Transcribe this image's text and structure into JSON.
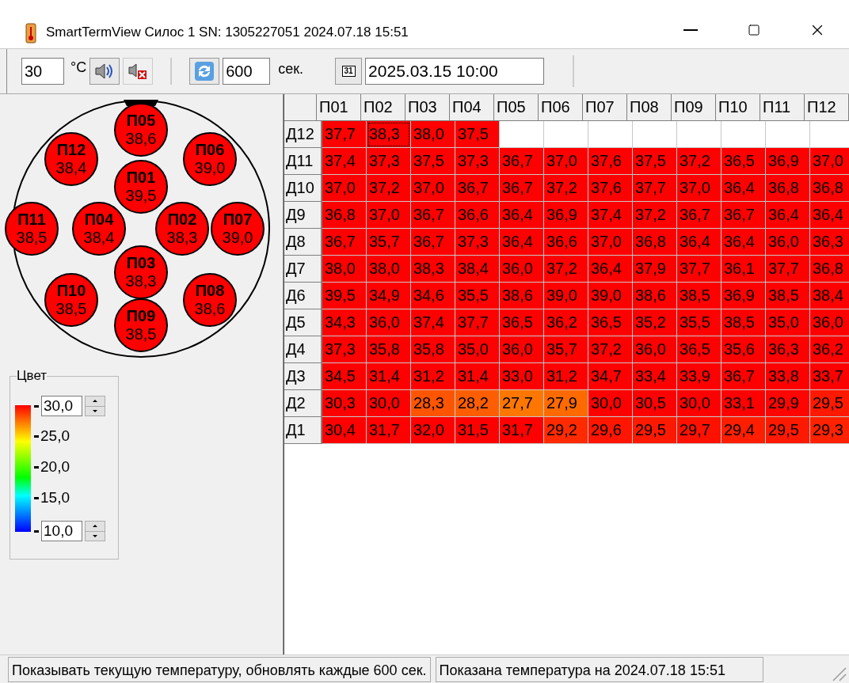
{
  "window": {
    "title": "SmartTermView Силос 1  SN: 1305227051  2024.07.18 15:51"
  },
  "toolbar": {
    "alarm_temp": "30",
    "temp_unit": "°C",
    "interval": "600",
    "interval_unit": "сек.",
    "calendar_glyph": "31",
    "date": "2025.03.15 10:00"
  },
  "silo": {
    "probes": [
      {
        "label": "П01",
        "value": "39,5"
      },
      {
        "label": "П02",
        "value": "38,3"
      },
      {
        "label": "П03",
        "value": "38,3"
      },
      {
        "label": "П04",
        "value": "38,4"
      },
      {
        "label": "П05",
        "value": "38,6"
      },
      {
        "label": "П06",
        "value": "39,0"
      },
      {
        "label": "П07",
        "value": "39,0"
      },
      {
        "label": "П08",
        "value": "38,6"
      },
      {
        "label": "П09",
        "value": "38,5"
      },
      {
        "label": "П10",
        "value": "38,5"
      },
      {
        "label": "П11",
        "value": "38,5"
      },
      {
        "label": "П12",
        "value": "38,4"
      }
    ]
  },
  "legend": {
    "title": "Цвет",
    "max": "30,0",
    "ticks": [
      "25,0",
      "20,0",
      "15,0"
    ],
    "min": "10,0"
  },
  "table": {
    "columns": [
      "П01",
      "П02",
      "П03",
      "П04",
      "П05",
      "П06",
      "П07",
      "П08",
      "П09",
      "П10",
      "П11",
      "П12"
    ],
    "rows": [
      {
        "label": "Д12",
        "cells": [
          {
            "v": "37,7",
            "selected": false
          },
          {
            "v": "38,3",
            "selected": true
          },
          {
            "v": "38,0",
            "selected": false
          },
          {
            "v": "37,5",
            "selected": false
          }
        ]
      },
      {
        "label": "Д11",
        "cells": [
          {
            "v": "37,4",
            "selected": false
          },
          {
            "v": "37,3",
            "selected": false
          },
          {
            "v": "37,5",
            "selected": false
          },
          {
            "v": "37,3",
            "selected": false
          },
          {
            "v": "36,7",
            "selected": false
          },
          {
            "v": "37,0",
            "selected": false
          },
          {
            "v": "37,6",
            "selected": false
          },
          {
            "v": "37,5",
            "selected": false
          },
          {
            "v": "37,2",
            "selected": false
          },
          {
            "v": "36,5",
            "selected": false
          },
          {
            "v": "36,9",
            "selected": false
          },
          {
            "v": "37,0",
            "selected": false
          }
        ]
      },
      {
        "label": "Д10",
        "cells": [
          {
            "v": "37,0",
            "selected": false
          },
          {
            "v": "37,2",
            "selected": false
          },
          {
            "v": "37,0",
            "selected": false
          },
          {
            "v": "36,7",
            "selected": false
          },
          {
            "v": "36,7",
            "selected": false
          },
          {
            "v": "37,2",
            "selected": false
          },
          {
            "v": "37,6",
            "selected": false
          },
          {
            "v": "37,7",
            "selected": false
          },
          {
            "v": "37,0",
            "selected": false
          },
          {
            "v": "36,4",
            "selected": false
          },
          {
            "v": "36,8",
            "selected": false
          },
          {
            "v": "36,8",
            "selected": false
          }
        ]
      },
      {
        "label": "Д9",
        "cells": [
          {
            "v": "36,8",
            "selected": false
          },
          {
            "v": "37,0",
            "selected": false
          },
          {
            "v": "36,7",
            "selected": false
          },
          {
            "v": "36,6",
            "selected": false
          },
          {
            "v": "36,4",
            "selected": false
          },
          {
            "v": "36,9",
            "selected": false
          },
          {
            "v": "37,4",
            "selected": false
          },
          {
            "v": "37,2",
            "selected": false
          },
          {
            "v": "36,7",
            "selected": false
          },
          {
            "v": "36,7",
            "selected": false
          },
          {
            "v": "36,4",
            "selected": false
          },
          {
            "v": "36,4",
            "selected": false
          }
        ]
      },
      {
        "label": "Д8",
        "cells": [
          {
            "v": "36,7",
            "selected": false
          },
          {
            "v": "35,7",
            "selected": false
          },
          {
            "v": "36,7",
            "selected": false
          },
          {
            "v": "37,3",
            "selected": false
          },
          {
            "v": "36,4",
            "selected": false
          },
          {
            "v": "36,6",
            "selected": false
          },
          {
            "v": "37,0",
            "selected": false
          },
          {
            "v": "36,8",
            "selected": false
          },
          {
            "v": "36,4",
            "selected": false
          },
          {
            "v": "36,4",
            "selected": false
          },
          {
            "v": "36,0",
            "selected": false
          },
          {
            "v": "36,3",
            "selected": false
          }
        ]
      },
      {
        "label": "Д7",
        "cells": [
          {
            "v": "38,0",
            "selected": false
          },
          {
            "v": "38,0",
            "selected": false
          },
          {
            "v": "38,3",
            "selected": false
          },
          {
            "v": "38,4",
            "selected": false
          },
          {
            "v": "36,0",
            "selected": false
          },
          {
            "v": "37,2",
            "selected": false
          },
          {
            "v": "36,4",
            "selected": false
          },
          {
            "v": "37,9",
            "selected": false
          },
          {
            "v": "37,7",
            "selected": false
          },
          {
            "v": "36,1",
            "selected": false
          },
          {
            "v": "37,7",
            "selected": false
          },
          {
            "v": "36,8",
            "selected": false
          }
        ]
      },
      {
        "label": "Д6",
        "cells": [
          {
            "v": "39,5",
            "selected": false
          },
          {
            "v": "34,9",
            "selected": false
          },
          {
            "v": "34,6",
            "selected": false
          },
          {
            "v": "35,5",
            "selected": false
          },
          {
            "v": "38,6",
            "selected": false
          },
          {
            "v": "39,0",
            "selected": false
          },
          {
            "v": "39,0",
            "selected": false
          },
          {
            "v": "38,6",
            "selected": false
          },
          {
            "v": "38,5",
            "selected": false
          },
          {
            "v": "36,9",
            "selected": false
          },
          {
            "v": "38,5",
            "selected": false
          },
          {
            "v": "38,4",
            "selected": false
          }
        ]
      },
      {
        "label": "Д5",
        "cells": [
          {
            "v": "34,3",
            "selected": false
          },
          {
            "v": "36,0",
            "selected": false
          },
          {
            "v": "37,4",
            "selected": false
          },
          {
            "v": "37,7",
            "selected": false
          },
          {
            "v": "36,5",
            "selected": false
          },
          {
            "v": "36,2",
            "selected": false
          },
          {
            "v": "36,5",
            "selected": false
          },
          {
            "v": "35,2",
            "selected": false
          },
          {
            "v": "35,5",
            "selected": false
          },
          {
            "v": "38,5",
            "selected": false
          },
          {
            "v": "35,0",
            "selected": false
          },
          {
            "v": "36,0",
            "selected": false
          }
        ]
      },
      {
        "label": "Д4",
        "cells": [
          {
            "v": "37,3",
            "selected": false
          },
          {
            "v": "35,8",
            "selected": false
          },
          {
            "v": "35,8",
            "selected": false
          },
          {
            "v": "35,0",
            "selected": false
          },
          {
            "v": "36,0",
            "selected": false
          },
          {
            "v": "35,7",
            "selected": false
          },
          {
            "v": "37,2",
            "selected": false
          },
          {
            "v": "36,0",
            "selected": false
          },
          {
            "v": "36,5",
            "selected": false
          },
          {
            "v": "35,6",
            "selected": false
          },
          {
            "v": "36,3",
            "selected": false
          },
          {
            "v": "36,2",
            "selected": false
          }
        ]
      },
      {
        "label": "Д3",
        "cells": [
          {
            "v": "34,5",
            "selected": false
          },
          {
            "v": "31,4",
            "selected": false
          },
          {
            "v": "31,2",
            "selected": false
          },
          {
            "v": "31,4",
            "selected": false
          },
          {
            "v": "33,0",
            "selected": false
          },
          {
            "v": "31,2",
            "selected": false
          },
          {
            "v": "34,7",
            "selected": false
          },
          {
            "v": "33,4",
            "selected": false
          },
          {
            "v": "33,9",
            "selected": false
          },
          {
            "v": "36,7",
            "selected": false
          },
          {
            "v": "33,8",
            "selected": false
          },
          {
            "v": "33,7",
            "selected": false
          }
        ]
      },
      {
        "label": "Д2",
        "cells": [
          {
            "v": "30,3",
            "selected": false
          },
          {
            "v": "30,0",
            "selected": false
          },
          {
            "v": "28,3",
            "selected": false
          },
          {
            "v": "28,2",
            "selected": false
          },
          {
            "v": "27,7",
            "selected": false
          },
          {
            "v": "27,9",
            "selected": false
          },
          {
            "v": "30,0",
            "selected": false
          },
          {
            "v": "30,5",
            "selected": false
          },
          {
            "v": "30,0",
            "selected": false
          },
          {
            "v": "33,1",
            "selected": false
          },
          {
            "v": "29,9",
            "selected": false
          },
          {
            "v": "29,5",
            "selected": false
          }
        ]
      },
      {
        "label": "Д1",
        "cells": [
          {
            "v": "30,4",
            "selected": false
          },
          {
            "v": "31,7",
            "selected": false
          },
          {
            "v": "32,0",
            "selected": false
          },
          {
            "v": "31,5",
            "selected": false
          },
          {
            "v": "31,7",
            "selected": false
          },
          {
            "v": "29,2",
            "selected": false
          },
          {
            "v": "29,6",
            "selected": false
          },
          {
            "v": "29,5",
            "selected": false
          },
          {
            "v": "29,7",
            "selected": false
          },
          {
            "v": "29,4",
            "selected": false
          },
          {
            "v": "29,5",
            "selected": false
          },
          {
            "v": "29,3",
            "selected": false
          }
        ]
      }
    ]
  },
  "status_bar": [
    "Показывать текущую температуру, обновлять каждые 600 сек.",
    "Показана температура на 2024.07.18 15:51"
  ]
}
